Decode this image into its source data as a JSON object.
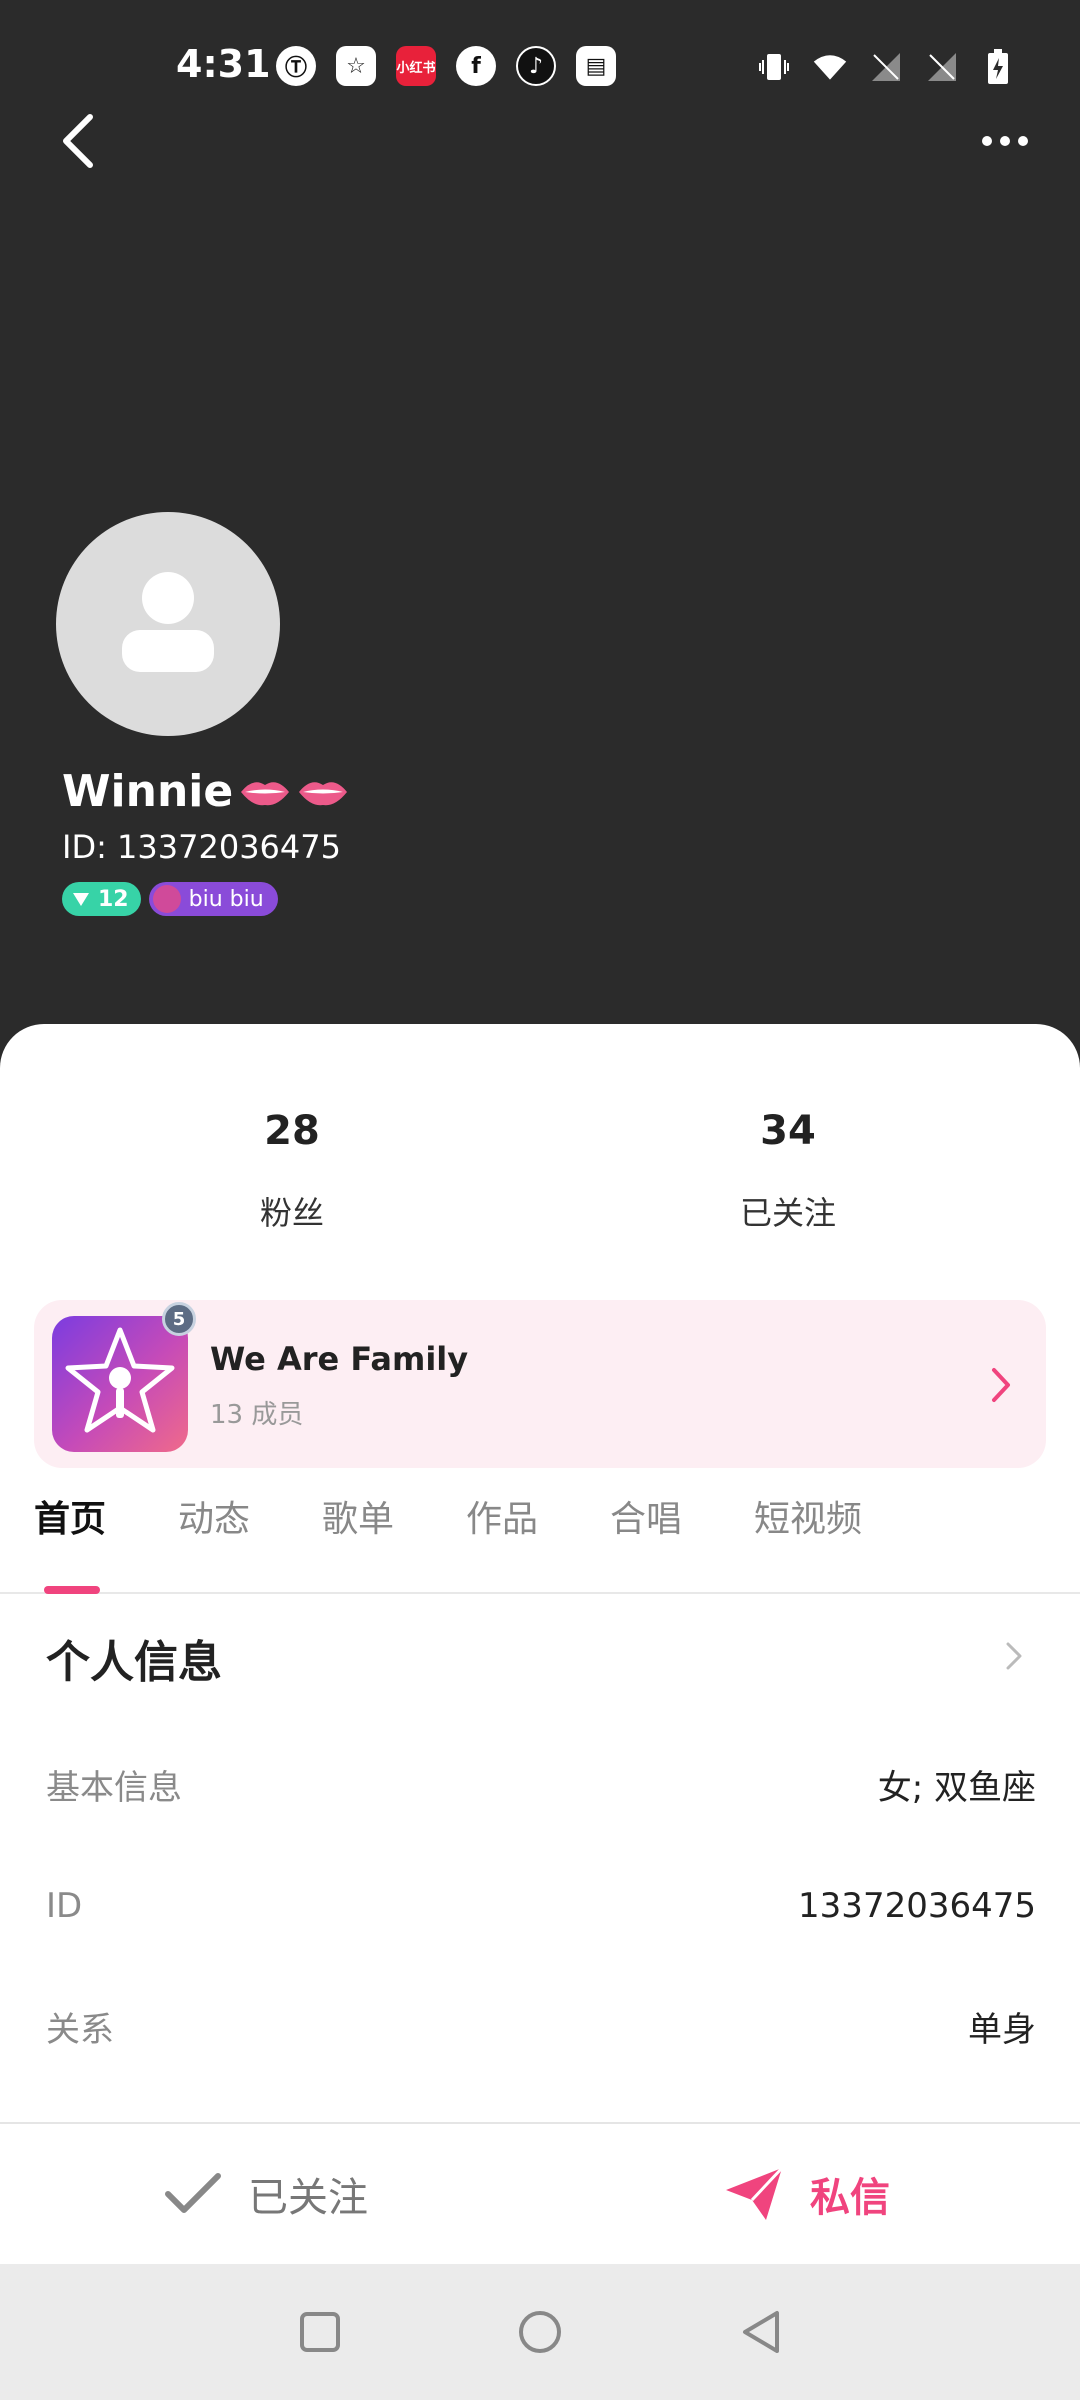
{
  "status_bar": {
    "time": "4:31",
    "notification_icons": [
      {
        "name": "app-notification-icon",
        "glyph": "Ⓣ"
      },
      {
        "name": "star-app-icon",
        "glyph": "☆"
      },
      {
        "name": "xiaohongshu-icon",
        "glyph": "小红书"
      },
      {
        "name": "facebook-icon",
        "glyph": "f"
      },
      {
        "name": "tiktok-icon",
        "glyph": "♪"
      },
      {
        "name": "wallet-app-icon",
        "glyph": "▤"
      }
    ]
  },
  "profile": {
    "name": "Winnie",
    "id_text": "ID: 13372036475",
    "level_badge": "12",
    "group_badge": "biu biu"
  },
  "stats": [
    {
      "value": "28",
      "label": "粉丝"
    },
    {
      "value": "34",
      "label": "已关注"
    }
  ],
  "family": {
    "name": "We Are Family",
    "members": "13 成员",
    "level": "5"
  },
  "tabs": [
    "首页",
    "动态",
    "歌单",
    "作品",
    "合唱",
    "短视频"
  ],
  "personal_info": {
    "title": "个人信息",
    "rows": [
      {
        "key": "基本信息",
        "value": "女; 双鱼座"
      },
      {
        "key": "ID",
        "value": "13372036475"
      },
      {
        "key": "关系",
        "value": "单身"
      }
    ]
  },
  "actions": {
    "follow_label": "已关注",
    "message_label": "私信"
  },
  "colors": {
    "accent": "#f0447e",
    "header_bg": "#2b2b2b",
    "family_bg": "#fdeef3",
    "level_badge": "#37d3a7",
    "group_badge": "#8a4bd9"
  }
}
